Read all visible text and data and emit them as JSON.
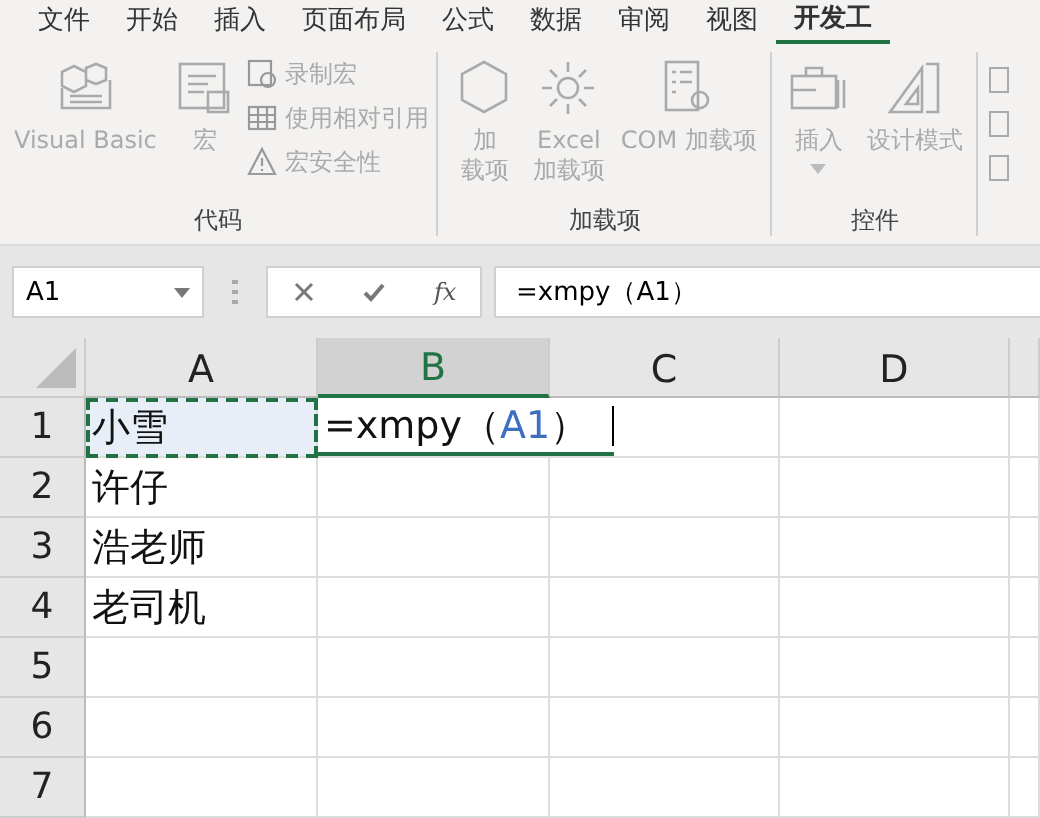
{
  "tabs": [
    {
      "label": "文件",
      "selected": false
    },
    {
      "label": "开始",
      "selected": false
    },
    {
      "label": "插入",
      "selected": false
    },
    {
      "label": "页面布局",
      "selected": false
    },
    {
      "label": "公式",
      "selected": false
    },
    {
      "label": "数据",
      "selected": false
    },
    {
      "label": "审阅",
      "selected": false
    },
    {
      "label": "视图",
      "selected": false
    },
    {
      "label": "开发工",
      "selected": true
    }
  ],
  "ribbon": {
    "groups": [
      {
        "label": "代码",
        "buttons": [
          {
            "kind": "large",
            "lines": [
              "Visual Basic"
            ],
            "disabled": true
          },
          {
            "kind": "large",
            "lines": [
              "宏"
            ],
            "disabled": true
          },
          {
            "kind": "small",
            "lines": [
              "录制宏"
            ],
            "disabled": true
          },
          {
            "kind": "small",
            "lines": [
              "使用相对引用"
            ],
            "disabled": true
          },
          {
            "kind": "small",
            "lines": [
              "宏安全性"
            ],
            "disabled": true
          }
        ]
      },
      {
        "label": "加载项",
        "buttons": [
          {
            "kind": "large",
            "lines": [
              "加",
              "载项"
            ],
            "disabled": true
          },
          {
            "kind": "large",
            "lines": [
              "Excel",
              "加载项"
            ],
            "disabled": true
          },
          {
            "kind": "large",
            "lines": [
              "COM 加载项"
            ],
            "disabled": true
          }
        ]
      },
      {
        "label": "控件",
        "buttons": [
          {
            "kind": "dropdown",
            "lines": [
              "插入"
            ],
            "disabled": true
          },
          {
            "kind": "large",
            "lines": [
              "设计模式"
            ],
            "disabled": true
          }
        ]
      }
    ]
  },
  "formula_bar": {
    "name_box": "A1",
    "function_button": "fx",
    "formula": "=xmpy（A1）"
  },
  "sheet": {
    "columns": [
      {
        "label": "A",
        "selected": false
      },
      {
        "label": "B",
        "selected": true
      },
      {
        "label": "C",
        "selected": false
      },
      {
        "label": "D",
        "selected": false
      }
    ],
    "rows": [
      {
        "number": "1",
        "cells": [
          {
            "kind": "text",
            "text": "小雪",
            "marquee": true
          },
          {
            "kind": "editor",
            "segments": [
              {
                "kind": "plain",
                "text": "=xmpy（"
              },
              {
                "kind": "ref",
                "text": "A1"
              },
              {
                "kind": "plain",
                "text": "）"
              }
            ]
          }
        ]
      },
      {
        "number": "2",
        "cells": [
          {
            "kind": "text",
            "text": "许仔",
            "marquee": false
          }
        ]
      },
      {
        "number": "3",
        "cells": [
          {
            "kind": "text",
            "text": "浩老师",
            "marquee": false
          }
        ]
      },
      {
        "number": "4",
        "cells": [
          {
            "kind": "text",
            "text": "老司机",
            "marquee": false
          }
        ]
      },
      {
        "number": "5",
        "cells": []
      },
      {
        "number": "6",
        "cells": []
      },
      {
        "number": "7",
        "cells": []
      }
    ]
  }
}
